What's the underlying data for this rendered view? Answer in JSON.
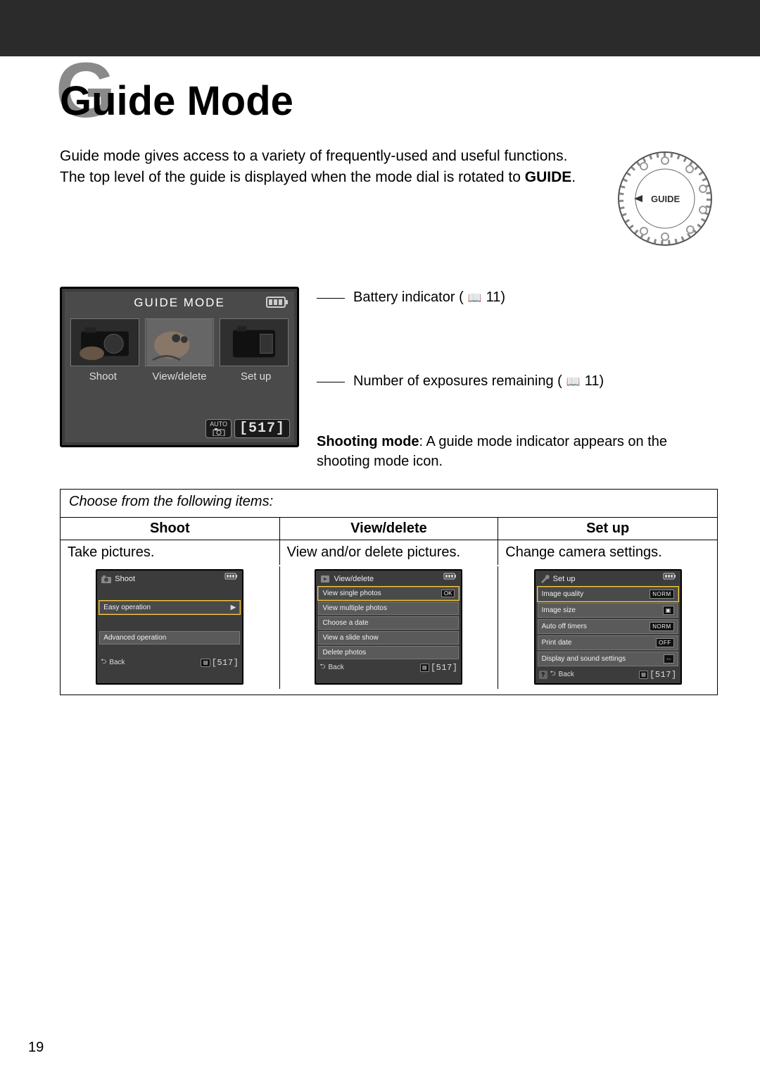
{
  "page_number": "19",
  "side_tab_letter": "G",
  "title_letter": "G",
  "title": "Guide Mode",
  "intro": {
    "part1": "Guide mode gives access to a variety of frequently-used and useful functions.  The top level of the guide is displayed when the mode dial is rotated to ",
    "bold": "GUIDE",
    "part2": "."
  },
  "dial_label": "GUIDE",
  "lcd": {
    "title": "GUIDE MODE",
    "tabs": {
      "a": "Shoot",
      "b": "View/delete",
      "c": "Set up"
    },
    "mode_icon_top": "AUTO",
    "counter": "517"
  },
  "annot": {
    "battery": "Battery indicator (",
    "battery_ref": " 11)",
    "exposures": "Number of exposures remaining (",
    "exposures_ref": " 11)",
    "shooting_label": "Shooting mode",
    "shooting_text": ": A guide mode indicator appears on the shooting mode icon."
  },
  "choose_line": "Choose from the following items:",
  "columns": {
    "headers": {
      "a": "Shoot",
      "b": "View/delete",
      "c": "Set up"
    },
    "desc": {
      "a": "Take pictures.",
      "b": "View and/or delete pictures.",
      "c": "Change camera settings."
    }
  },
  "sub": {
    "shoot": {
      "title": "Shoot",
      "i1": "Easy operation",
      "i2": "Advanced operation",
      "back": "Back",
      "count": "517"
    },
    "view": {
      "title": "View/delete",
      "i1": "View single photos",
      "i2": "View multiple photos",
      "i3": "Choose a date",
      "i4": "View a slide show",
      "i5": "Delete photos",
      "ok": "OK",
      "back": "Back",
      "count": "517"
    },
    "setup": {
      "title": "Set up",
      "i1": "Image quality",
      "i1v": "NORM",
      "i2": "Image size",
      "i3": "Auto off timers",
      "i3v": "NORM",
      "i4": "Print date",
      "i4v": "OFF",
      "i5": "Display and sound settings",
      "i5v": "--",
      "back": "Back",
      "count": "517",
      "help": "?"
    }
  }
}
